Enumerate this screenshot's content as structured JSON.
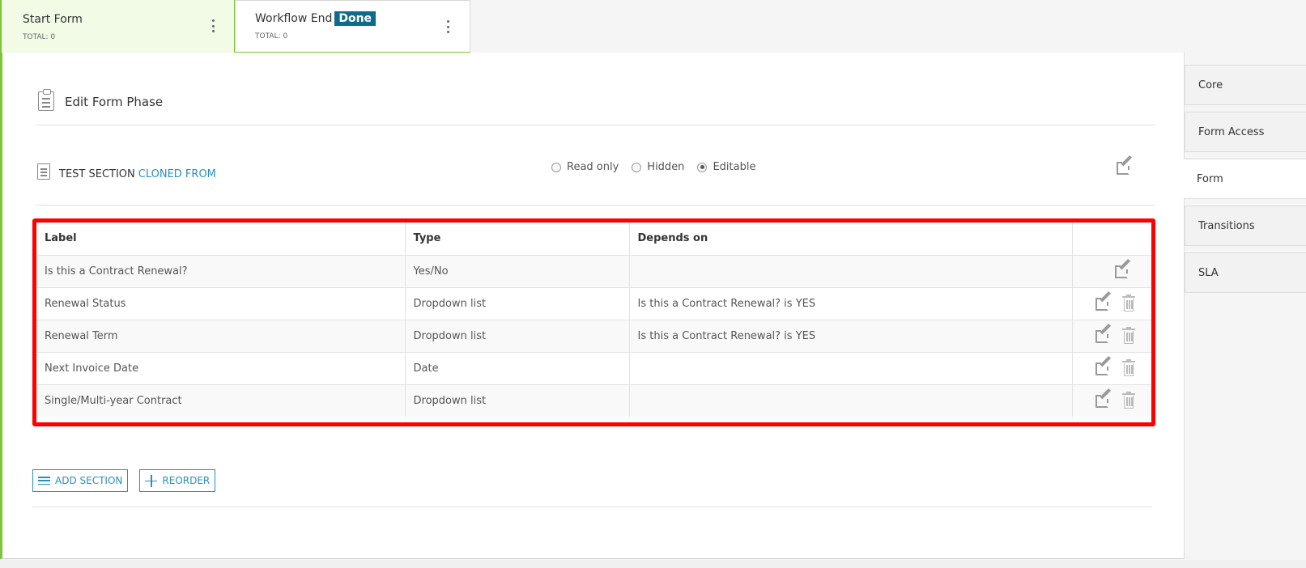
{
  "phases": [
    {
      "title": "Start Form",
      "badge": "",
      "total": "TOTAL: 0"
    },
    {
      "title": "Workflow End",
      "badge": "Done",
      "total": "TOTAL: 0"
    }
  ],
  "edit_header": {
    "title": "Edit Form Phase"
  },
  "section": {
    "title": "TEST SECTION",
    "cloned_label": "CLONED FROM",
    "access_options": [
      "Read only",
      "Hidden",
      "Editable"
    ],
    "selected_access": "Editable"
  },
  "table": {
    "headers": [
      "Label",
      "Type",
      "Depends on",
      ""
    ],
    "rows": [
      {
        "label": "Is this a Contract Renewal?",
        "type": "Yes/No",
        "depends_on": ""
      },
      {
        "label": "Renewal Status",
        "type": "Dropdown list",
        "depends_on": "Is this a Contract Renewal? is YES"
      },
      {
        "label": "Renewal Term",
        "type": "Dropdown list",
        "depends_on": "Is this a Contract Renewal? is YES"
      },
      {
        "label": "Next Invoice Date",
        "type": "Date",
        "depends_on": ""
      },
      {
        "label": "Single/Multi-year Contract",
        "type": "Dropdown list",
        "depends_on": ""
      }
    ]
  },
  "buttons": {
    "add_section": "ADD SECTION",
    "reorder": "REORDER"
  },
  "side_tabs": [
    "Core",
    "Form Access",
    "Form",
    "Transitions",
    "SLA"
  ],
  "active_side_tab": "Form",
  "colors": {
    "accent_green": "#7cc43a",
    "link_blue": "#2a8fbd",
    "done_badge": "#0d6b8c",
    "highlight_red": "#ff0000"
  }
}
